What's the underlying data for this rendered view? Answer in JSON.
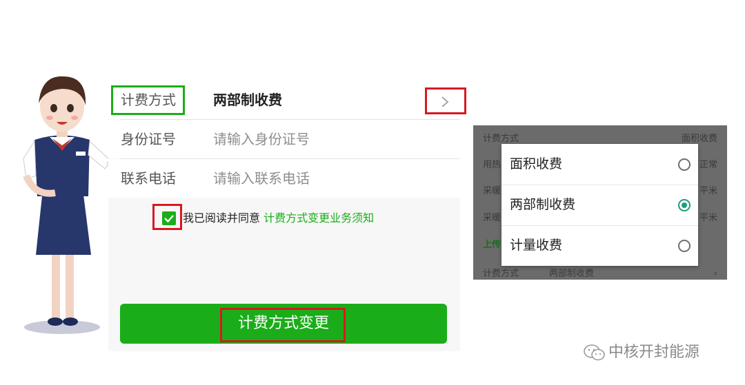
{
  "form": {
    "rows": [
      {
        "label": "计费方式",
        "value": "两部制收费"
      },
      {
        "label": "身份证号",
        "placeholder": "请输入身份证号"
      },
      {
        "label": "联系电话",
        "placeholder": "请输入联系电话"
      }
    ],
    "agreement": {
      "text": "我已阅读并同意",
      "link": "计费方式变更业务须知",
      "checked": true
    },
    "submit_label": "计费方式变更"
  },
  "dialog": {
    "background_rows": [
      {
        "label": "计费方式",
        "value": "面积收费"
      },
      {
        "label": "用热",
        "value": "正常"
      },
      {
        "label": "采暖",
        "value": "平米"
      },
      {
        "label": "采暖",
        "value": "平米"
      },
      {
        "label": "上传",
        "value": ""
      },
      {
        "label": "计费方式",
        "value": "两部制收费"
      }
    ],
    "options": [
      {
        "label": "面积收费",
        "selected": false
      },
      {
        "label": "两部制收费",
        "selected": true
      },
      {
        "label": "计量收费",
        "selected": false
      }
    ]
  },
  "watermark": "中核开封能源",
  "colors": {
    "accent": "#1aad19",
    "highlight": "#d71920",
    "radio": "#1f9c7c"
  }
}
